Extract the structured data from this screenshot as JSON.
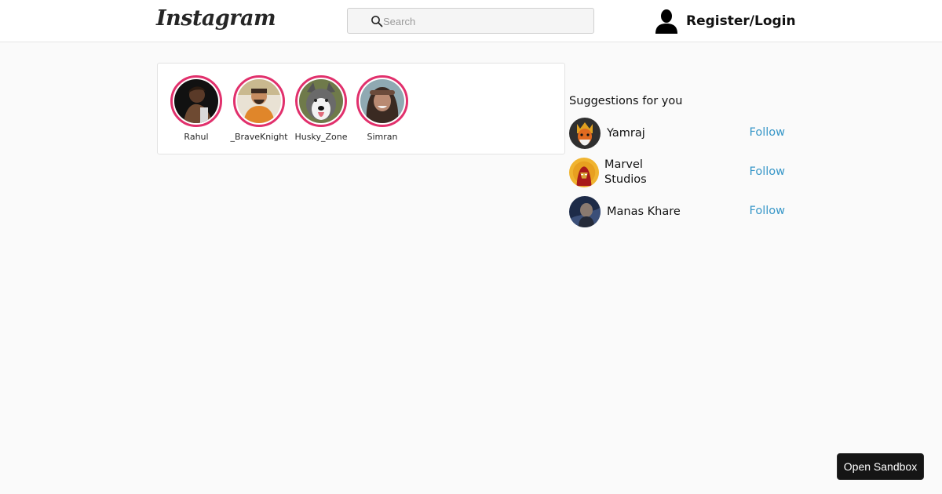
{
  "header": {
    "logo_text": "Instagram",
    "search": {
      "placeholder": "Search",
      "value": "",
      "icon": "search-icon"
    },
    "account": {
      "icon": "user-icon",
      "label": "Register/Login"
    }
  },
  "stories": [
    {
      "name": "Rahul"
    },
    {
      "name": "_BraveKnight"
    },
    {
      "name": "Husky_Zone"
    },
    {
      "name": "Simran"
    }
  ],
  "suggestions": {
    "title": "Suggestions for you",
    "items": [
      {
        "name": "Yamraj",
        "action": "Follow"
      },
      {
        "name": "Marvel Studios",
        "action": "Follow"
      },
      {
        "name": "Manas Khare",
        "action": "Follow"
      }
    ]
  },
  "sandbox_button": "Open Sandbox",
  "colors": {
    "story_ring": "#e1306c",
    "follow_link": "#3897c8",
    "page_background": "#fafafa"
  }
}
